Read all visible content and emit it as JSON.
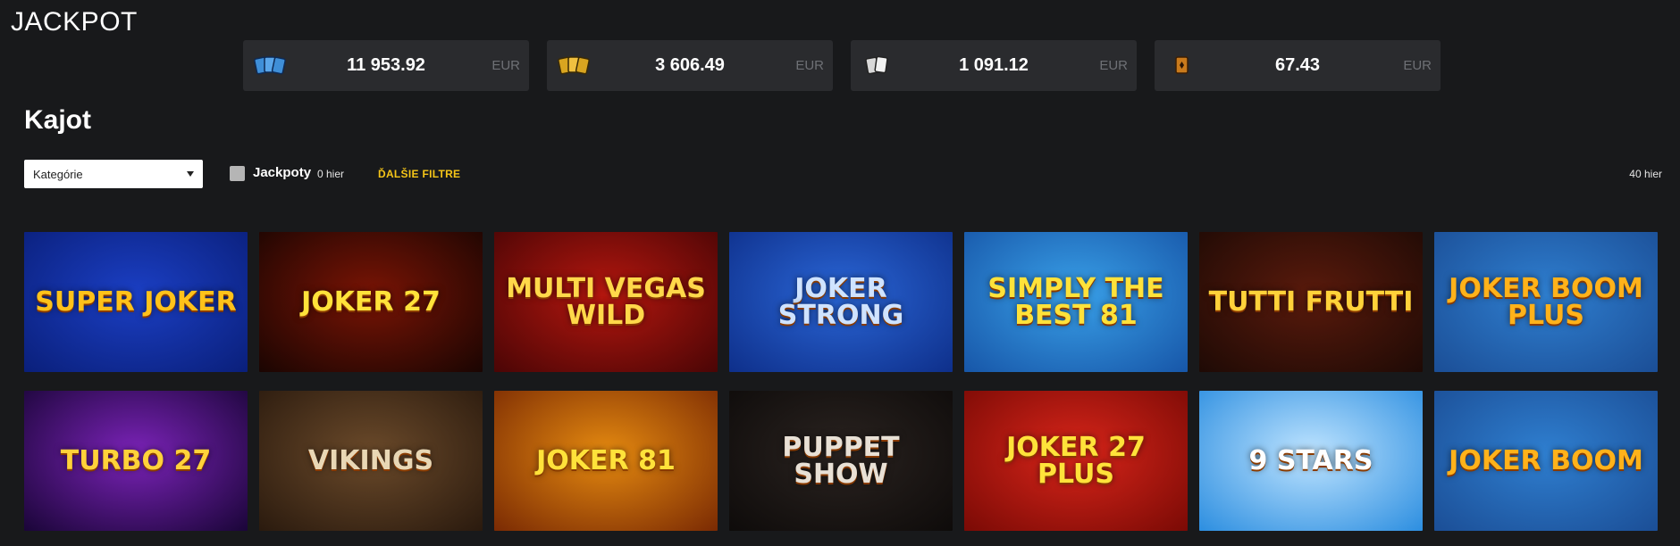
{
  "jackpot": {
    "title": "JACKPOT",
    "cards": [
      {
        "icon": "cards-blue-icon",
        "amount": "11 953.92",
        "currency": "EUR",
        "color": "#3f8fd8"
      },
      {
        "icon": "cards-gold-icon",
        "amount": "3 606.49",
        "currency": "EUR",
        "color": "#d9a520"
      },
      {
        "icon": "cards-silver-icon",
        "amount": "1 091.12",
        "currency": "EUR",
        "color": "#d9d9d9"
      },
      {
        "icon": "card-bronze-icon",
        "amount": "67.43",
        "currency": "EUR",
        "color": "#c97a1c"
      }
    ]
  },
  "section": {
    "title": "Kajot"
  },
  "filters": {
    "category_placeholder": "Kategórie",
    "jackpot_label": "Jackpoty",
    "jackpot_count": "0 hier",
    "more_filters": "ĎALŠIE FILTRE",
    "total_count": "40 hier"
  },
  "games": [
    {
      "name": "SUPER JOKER",
      "bg1": "#1b3fc4",
      "bg2": "#0a1f7a",
      "text": "#ffc21a"
    },
    {
      "name": "Joker 27",
      "bg1": "#7a1405",
      "bg2": "#1a0502",
      "text": "#ffe23a"
    },
    {
      "name": "Multi VEGAS WILD",
      "bg1": "#b5170f",
      "bg2": "#4a0505",
      "text": "#ffd84a"
    },
    {
      "name": "JOKER STRONG",
      "bg1": "#2a66d6",
      "bg2": "#0e2f8a",
      "text": "#cfe3ff"
    },
    {
      "name": "SIMPLY THE BEST 81",
      "bg1": "#39a0e8",
      "bg2": "#1756a8",
      "text": "#ffe23a"
    },
    {
      "name": "TUTTI FRUTTI",
      "bg1": "#5a1a0c",
      "bg2": "#1e0a05",
      "text": "#ffd23a"
    },
    {
      "name": "JOKER BOOM PLUS",
      "bg1": "#2f7fd0",
      "bg2": "#1b4e96",
      "text": "#ffb21a"
    },
    {
      "name": "TURBO 27",
      "bg1": "#7b23b8",
      "bg2": "#1a0538",
      "text": "#ffd23a"
    },
    {
      "name": "VIKINGS",
      "bg1": "#6b4a2a",
      "bg2": "#2a1a0e",
      "text": "#e8d7b5"
    },
    {
      "name": "JOKER 81",
      "bg1": "#e58a10",
      "bg2": "#7a2a03",
      "text": "#ffe23a"
    },
    {
      "name": "PUPPET SHOW",
      "bg1": "#2a2320",
      "bg2": "#0e0b0a",
      "text": "#e8e0d5"
    },
    {
      "name": "JOKER 27 Plus",
      "bg1": "#d8251a",
      "bg2": "#7a0a05",
      "text": "#ffe23a"
    },
    {
      "name": "9 STARS",
      "bg1": "#bfe4ff",
      "bg2": "#2c8ee0",
      "text": "#ffffff"
    },
    {
      "name": "JOKER BOOM",
      "bg1": "#2f7fd0",
      "bg2": "#1b4e96",
      "text": "#ffb21a"
    }
  ]
}
